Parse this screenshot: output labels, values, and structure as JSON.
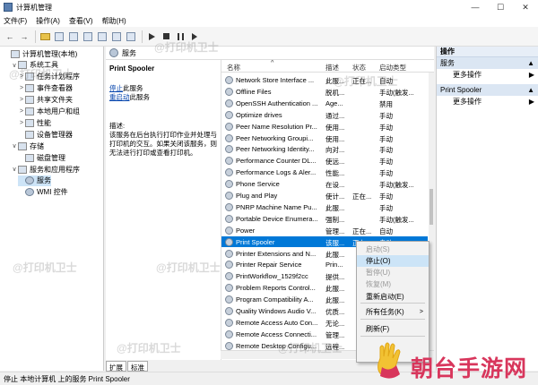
{
  "window": {
    "title": "计算机管理",
    "controls": [
      "—",
      "☐",
      "✕"
    ]
  },
  "menu": [
    "文件(F)",
    "操作(A)",
    "查看(V)",
    "帮助(H)"
  ],
  "tree": {
    "items": [
      {
        "label": "计算机管理(本地)",
        "level": 0,
        "exp": "",
        "icon": "computer-icon"
      },
      {
        "label": "系统工具",
        "level": 1,
        "exp": "∨",
        "icon": "tools-icon"
      },
      {
        "label": "任务计划程序",
        "level": 2,
        "exp": ">",
        "icon": "clock-icon"
      },
      {
        "label": "事件查看器",
        "level": 2,
        "exp": ">",
        "icon": "event-icon"
      },
      {
        "label": "共享文件夹",
        "level": 2,
        "exp": ">",
        "icon": "folder-icon"
      },
      {
        "label": "本地用户和组",
        "level": 2,
        "exp": ">",
        "icon": "users-icon"
      },
      {
        "label": "性能",
        "level": 2,
        "exp": ">",
        "icon": "perf-icon"
      },
      {
        "label": "设备管理器",
        "level": 2,
        "exp": "",
        "icon": "device-icon"
      },
      {
        "label": "存储",
        "level": 1,
        "exp": "∨",
        "icon": "storage-icon"
      },
      {
        "label": "磁盘管理",
        "level": 2,
        "exp": "",
        "icon": "disk-icon"
      },
      {
        "label": "服务和应用程序",
        "level": 1,
        "exp": "∨",
        "icon": "apps-icon"
      },
      {
        "label": "服务",
        "level": 2,
        "exp": "",
        "icon": "services-icon",
        "selected": true
      },
      {
        "label": "WMI 控件",
        "level": 2,
        "exp": "",
        "icon": "wmi-icon"
      }
    ]
  },
  "middle": {
    "header": "服务",
    "service_title": "Print Spooler",
    "stop_link": "停止",
    "stop_suffix": "此服务",
    "restart_link": "重启动",
    "restart_suffix": "此服务",
    "desc_label": "描述:",
    "desc_text_1": "该服务在后台执行打印作业并处理与",
    "desc_text_2": "打印机的交互。如果关闭该服务，则",
    "desc_text_3": "无法进行打印或查看打印机。"
  },
  "list": {
    "headers": {
      "name": "名称",
      "desc": "描述",
      "status": "状态",
      "startup": "启动类型",
      "sort_indicator": "^"
    },
    "rows": [
      {
        "name": "Network Store Interface ...",
        "desc": "此服...",
        "status": "正在...",
        "startup": "自动"
      },
      {
        "name": "Offline Files",
        "desc": "脱机...",
        "status": "",
        "startup": "手动(触发..."
      },
      {
        "name": "OpenSSH Authentication ...",
        "desc": "Age...",
        "status": "",
        "startup": "禁用"
      },
      {
        "name": "Optimize drives",
        "desc": "通过...",
        "status": "",
        "startup": "手动"
      },
      {
        "name": "Peer Name Resolution Pr...",
        "desc": "使用...",
        "status": "",
        "startup": "手动"
      },
      {
        "name": "Peer Networking Groupi...",
        "desc": "使用...",
        "status": "",
        "startup": "手动"
      },
      {
        "name": "Peer Networking Identity...",
        "desc": "向对...",
        "status": "",
        "startup": "手动"
      },
      {
        "name": "Performance Counter DL...",
        "desc": "使远...",
        "status": "",
        "startup": "手动"
      },
      {
        "name": "Performance Logs & Aler...",
        "desc": "性能...",
        "status": "",
        "startup": "手动"
      },
      {
        "name": "Phone Service",
        "desc": "在设...",
        "status": "",
        "startup": "手动(触发..."
      },
      {
        "name": "Plug and Play",
        "desc": "使计...",
        "status": "正在...",
        "startup": "手动"
      },
      {
        "name": "PNRP Machine Name Pu...",
        "desc": "此服...",
        "status": "",
        "startup": "手动"
      },
      {
        "name": "Portable Device Enumera...",
        "desc": "强制...",
        "status": "",
        "startup": "手动(触发..."
      },
      {
        "name": "Power",
        "desc": "管理...",
        "status": "正在...",
        "startup": "自动"
      },
      {
        "name": "Print Spooler",
        "desc": "该服...",
        "status": "正在...",
        "startup": "自动",
        "selected": true
      },
      {
        "name": "Printer Extensions and N...",
        "desc": "此服...",
        "status": "",
        "startup": ""
      },
      {
        "name": "Printer Repair Service",
        "desc": "Prin...",
        "status": "",
        "startup": ""
      },
      {
        "name": "PrintWorkflow_1529f2cc",
        "desc": "提供...",
        "status": "",
        "startup": ""
      },
      {
        "name": "Problem Reports Control...",
        "desc": "此服...",
        "status": "",
        "startup": ""
      },
      {
        "name": "Program Compatibility A...",
        "desc": "此服...",
        "status": "",
        "startup": ""
      },
      {
        "name": "Quality Windows Audio V...",
        "desc": "优质...",
        "status": "",
        "startup": ""
      },
      {
        "name": "Remote Access Auto Con...",
        "desc": "无论...",
        "status": "",
        "startup": ""
      },
      {
        "name": "Remote Access Connecti...",
        "desc": "管理...",
        "status": "",
        "startup": ""
      },
      {
        "name": "Remote Desktop Configu...",
        "desc": "远程...",
        "status": "",
        "startup": ""
      }
    ]
  },
  "tabs": [
    "扩展",
    "标准"
  ],
  "actions": {
    "header": "操作",
    "sections": [
      {
        "title": "服务",
        "item": "更多操作"
      },
      {
        "title": "Print Spooler",
        "item": "更多操作"
      }
    ]
  },
  "context_menu": {
    "items": [
      {
        "label": "启动(S)",
        "disabled": true
      },
      {
        "label": "停止(O)",
        "highlight": true
      },
      {
        "label": "暂停(U)",
        "disabled": true
      },
      {
        "label": "恢复(M)",
        "disabled": true
      },
      {
        "label": "重新启动(E)"
      },
      {
        "label": "所有任务(K)",
        "submenu": true
      },
      {
        "label": "刷新(F)"
      }
    ]
  },
  "statusbar": "停止 本地计算机 上的服务 Print Spooler",
  "watermarks": [
    "@打印机卫士",
    "@打印机卫士",
    "@打印机卫士",
    "@打印机卫士",
    "@打印机卫士",
    "@打印机卫士",
    "@打印机卫士"
  ],
  "brand_text": "朝台手游网"
}
